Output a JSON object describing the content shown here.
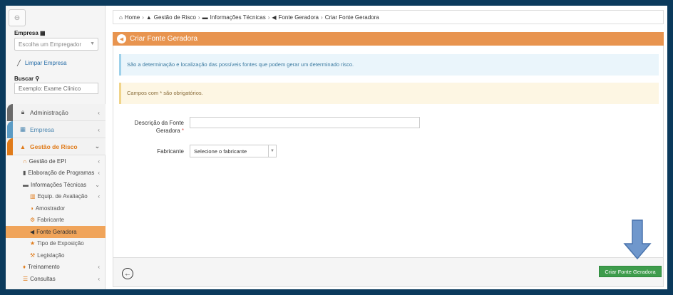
{
  "sidebar": {
    "collapse_icon": "circle-arrow-left-icon",
    "empresa_label": "Empresa",
    "empresa_placeholder": "Escolha um Empregador",
    "limpar_label": "Limpar Empresa",
    "buscar_label": "Buscar",
    "buscar_value": "Exemplo: Exame Clínico",
    "menu": {
      "administracao": "Administração",
      "empresa": "Empresa",
      "gestao_risco": "Gestão de Risco",
      "gestao_epi": "Gestão de EPI",
      "elaboracao_programas": "Elaboração de Programas",
      "informacoes_tecnicas": "Informações Técnicas",
      "equip_avaliacao": "Equip. de Avaliação",
      "amostrador": "Amostrador",
      "fabricante": "Fabricante",
      "fonte_geradora": "Fonte Geradora",
      "tipo_exposicao": "Tipo de Exposição",
      "legislacao": "Legislação",
      "treinamento": "Treinamento",
      "consultas": "Consultas"
    }
  },
  "breadcrumb": {
    "home": "Home",
    "gestao_risco": "Gestão de Risco",
    "informacoes_tecnicas": "Informações Técnicas",
    "fonte_geradora": "Fonte Geradora",
    "current": "Criar Fonte Geradora"
  },
  "panel": {
    "title": "Criar Fonte Geradora",
    "info_text": "São a determinação e localização das possíveis fontes que podem gerar um determinado risco.",
    "warning_text": "Campos com * são obrigatórios.",
    "descricao_label_line1": "Descrição da Fonte",
    "descricao_label_line2": "Geradora",
    "required_mark": "*",
    "descricao_value": "",
    "fabricante_label": "Fabricante",
    "fabricante_placeholder": "Selecione o fabricante",
    "submit_label": "Criar Fonte Geradora"
  },
  "colors": {
    "accent": "#e8944f",
    "selected_menu": "#f0a45a",
    "submit": "#3e9c4c",
    "annotation_arrow": "#6f97cc"
  }
}
